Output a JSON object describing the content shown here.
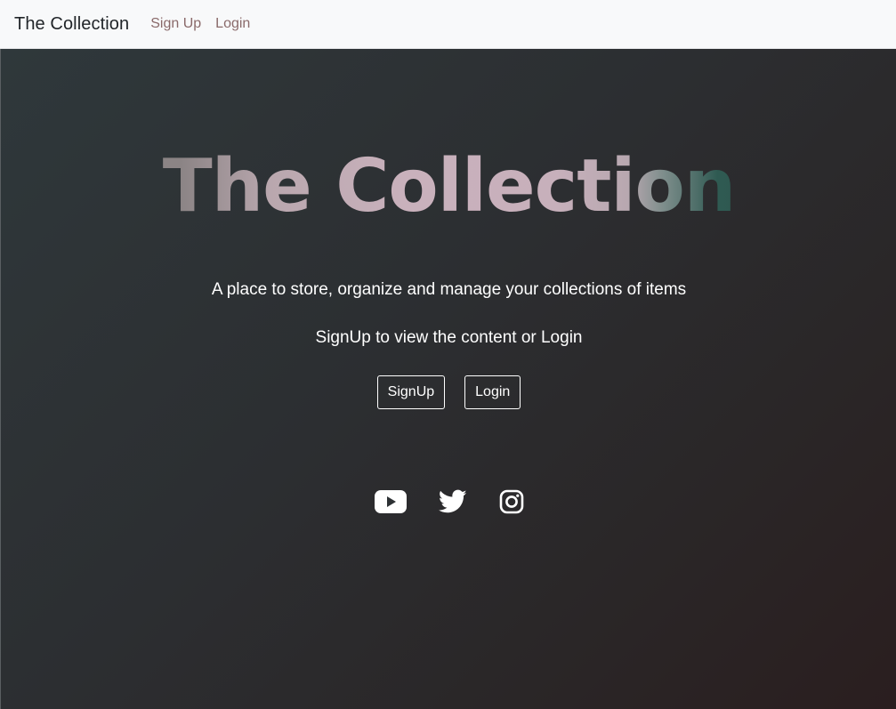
{
  "navbar": {
    "brand": "The Collection",
    "links": [
      "Sign Up",
      "Login"
    ]
  },
  "hero": {
    "title": "The Collection",
    "tagline": "A place to store, organize and manage your collections of items",
    "subline": "SignUp to view the content or Login",
    "buttons": {
      "signup": "SignUp",
      "login": "Login"
    },
    "social": [
      "youtube-icon",
      "twitter-icon",
      "instagram-icon"
    ]
  },
  "colors": {
    "navbar_bg": "#f8f9fa",
    "nav_link": "#8a6a6a",
    "hero_bg_start": "#2f383b",
    "hero_bg_end": "#2a1e1f",
    "text": "#ffffff"
  }
}
